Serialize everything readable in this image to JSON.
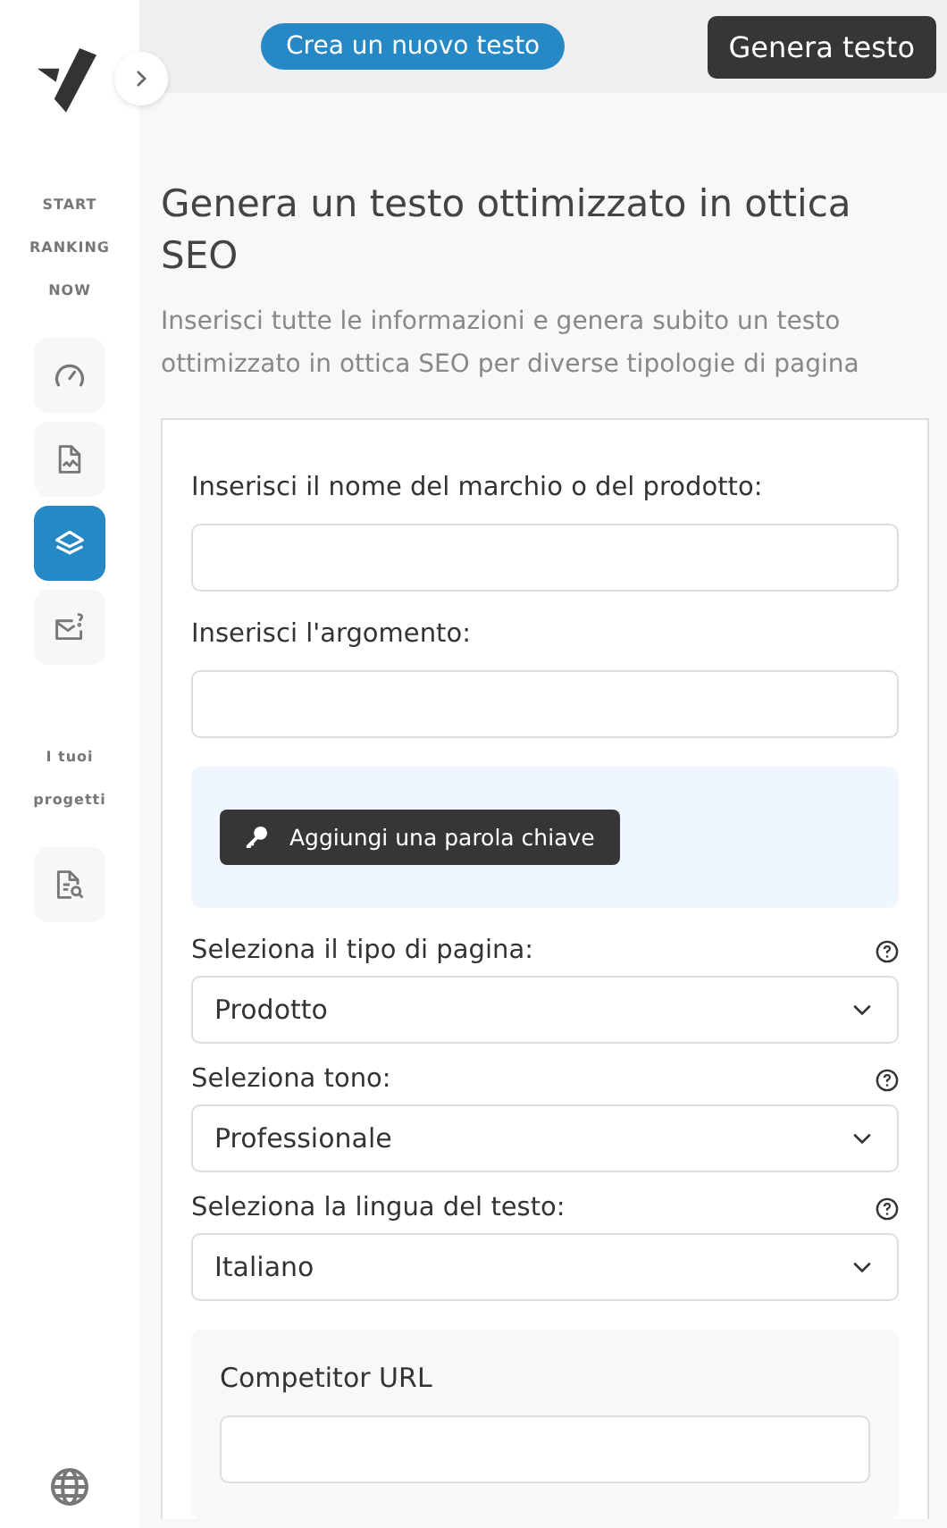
{
  "header": {
    "new_text_button": "Crea un nuovo testo",
    "generate_button": "Genera testo"
  },
  "sidebar": {
    "sections": [
      {
        "title": "START RANKING NOW",
        "items": [
          {
            "kind": "gauge",
            "selected": false
          },
          {
            "kind": "chart",
            "selected": false
          },
          {
            "kind": "layers",
            "selected": true
          },
          {
            "kind": "mail",
            "selected": false
          }
        ]
      },
      {
        "title": "I tuoi progetti",
        "items": [
          {
            "kind": "search",
            "selected": false
          }
        ]
      }
    ]
  },
  "page": {
    "title": "Genera un testo ottimizzato in ottica SEO",
    "subtitle": "Inserisci tutte le informazioni e genera subito un testo ottimizzato in ottica SEO per diverse tipologie di pagina"
  },
  "form": {
    "fields": [
      {
        "kind": "text",
        "label": "Inserisci il nome del marchio o del prodotto:"
      },
      {
        "kind": "text",
        "label": "Inserisci l'argomento:"
      },
      {
        "kind": "keyword",
        "button": "Aggiungi una parola chiave"
      },
      {
        "kind": "select",
        "label": "Seleziona il tipo di pagina:",
        "value": "Prodotto",
        "help": true
      },
      {
        "kind": "select",
        "label": "Seleziona tono:",
        "value": "Professionale",
        "help": true
      },
      {
        "kind": "select",
        "label": "Seleziona la lingua del testo:",
        "value": "Italiano",
        "help": true
      },
      {
        "kind": "competitor",
        "label": "Competitor URL"
      }
    ]
  }
}
